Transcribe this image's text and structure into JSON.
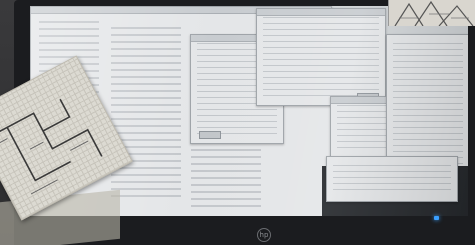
{
  "monitor": {
    "brand_logo_text": "hp"
  }
}
